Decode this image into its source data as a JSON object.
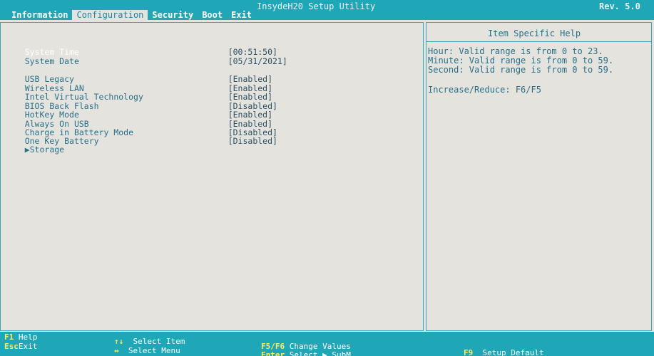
{
  "header": {
    "title": "InsydeH20 Setup Utility",
    "revision": "Rev. 5.0",
    "tabs": [
      {
        "label": "Information",
        "active": false
      },
      {
        "label": "Configuration",
        "active": true
      },
      {
        "label": "Security",
        "active": false
      },
      {
        "label": "Boot",
        "active": false
      },
      {
        "label": "Exit",
        "active": false
      }
    ]
  },
  "settings": [
    {
      "label": "System Time",
      "value": "[00:51:50]",
      "selected": true
    },
    {
      "label": "System Date",
      "value": "[05/31/2021]"
    },
    {
      "label": "USB Legacy",
      "value": "[Enabled]"
    },
    {
      "label": "Wireless LAN",
      "value": "[Enabled]"
    },
    {
      "label": "Intel Virtual Technology",
      "value": "[Enabled]"
    },
    {
      "label": "BIOS Back Flash",
      "value": "[Disabled]"
    },
    {
      "label": "HotKey Mode",
      "value": "[Enabled]"
    },
    {
      "label": "Always On USB",
      "value": "[Enabled]"
    },
    {
      "label": "Charge in Battery Mode",
      "value": "[Disabled]"
    },
    {
      "label": "One Key Battery",
      "value": "[Disabled]"
    },
    {
      "label": "▶Storage",
      "value": ""
    }
  ],
  "help": {
    "title": "Item Specific Help",
    "lines": [
      "Hour: Valid range is from 0 to 23.",
      "Minute: Valid range is from 0 to 59.",
      "Second: Valid range is from 0 to 59."
    ],
    "extra": "Increase/Reduce: F6/F5"
  },
  "footer": {
    "f1_key": "F1",
    "f1_label": "Help",
    "esc_key": "Esc",
    "esc_label": "Exit",
    "updown_key": "↑↓",
    "updown_label": "Select Item",
    "leftright_key": "↔",
    "leftright_label": "Select Menu",
    "f5f6_key": "F5/F6",
    "f5f6_label": "Change Values",
    "enter_key": "Enter",
    "enter_label": "Select ▶ SubM",
    "f9_key": "F9",
    "f9_label": "Setup Default"
  },
  "colors": {
    "bar": "#1fa7b8",
    "panel_bg": "#e4e3dd",
    "text": "#2a6f8a",
    "key_highlight": "#ffeb55"
  }
}
